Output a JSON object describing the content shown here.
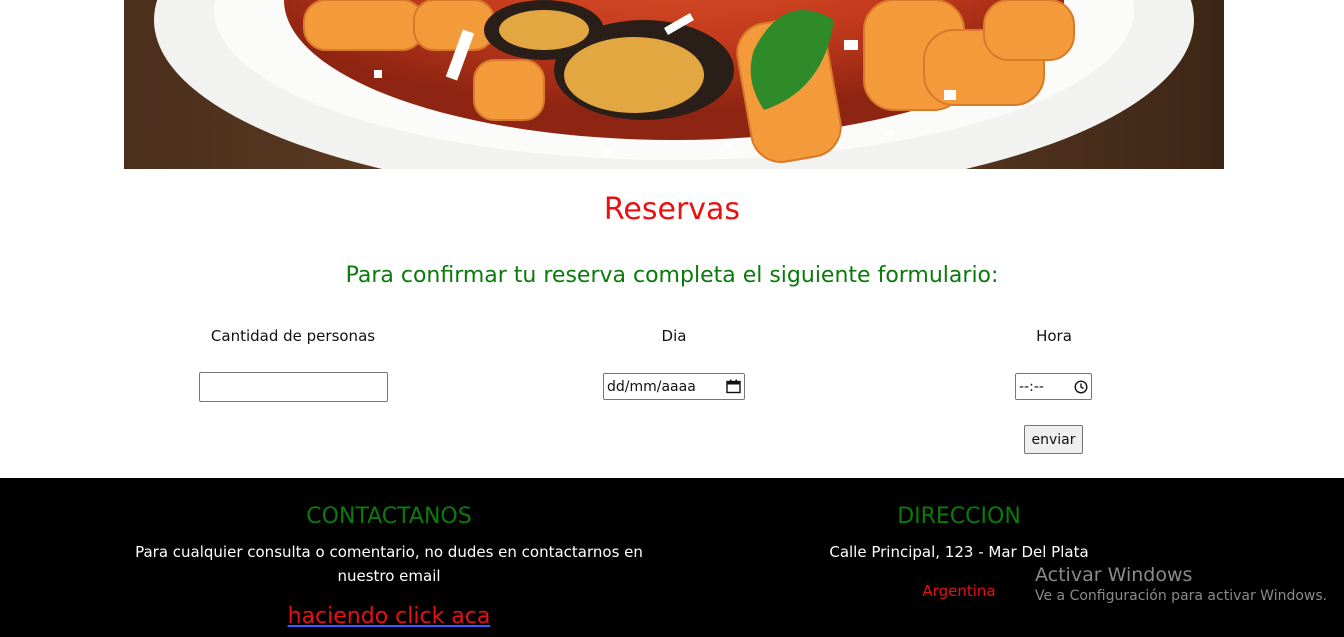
{
  "reservas": {
    "title": "Reservas",
    "subtitle": "Para confirmar tu reserva completa el siguiente formulario:",
    "fields": {
      "personas_label": "Cantidad de personas",
      "personas_value": "",
      "dia_label": "Dia",
      "dia_placeholder": "dd/mm/aaaa",
      "hora_label": "Hora",
      "hora_placeholder": "--:--"
    },
    "submit_label": "enviar"
  },
  "footer": {
    "contact": {
      "heading": "CONTACTANOS",
      "text": "Para cualquier consulta o comentario, no dudes en contactarnos en nuestro email",
      "link": "haciendo click aca"
    },
    "address": {
      "heading": "DIRECCION",
      "street": "Calle Principal, 123 - Mar Del Plata",
      "country": "Argentina"
    }
  },
  "watermark": {
    "title": "Activar Windows",
    "subtitle": "Ve a Configuración para activar Windows."
  },
  "colors": {
    "title_red": "#e81010",
    "subtitle_green": "#0a7a0a",
    "footer_bg": "#000000"
  },
  "icons": {
    "calendar": "calendar-icon",
    "clock": "clock-icon"
  }
}
